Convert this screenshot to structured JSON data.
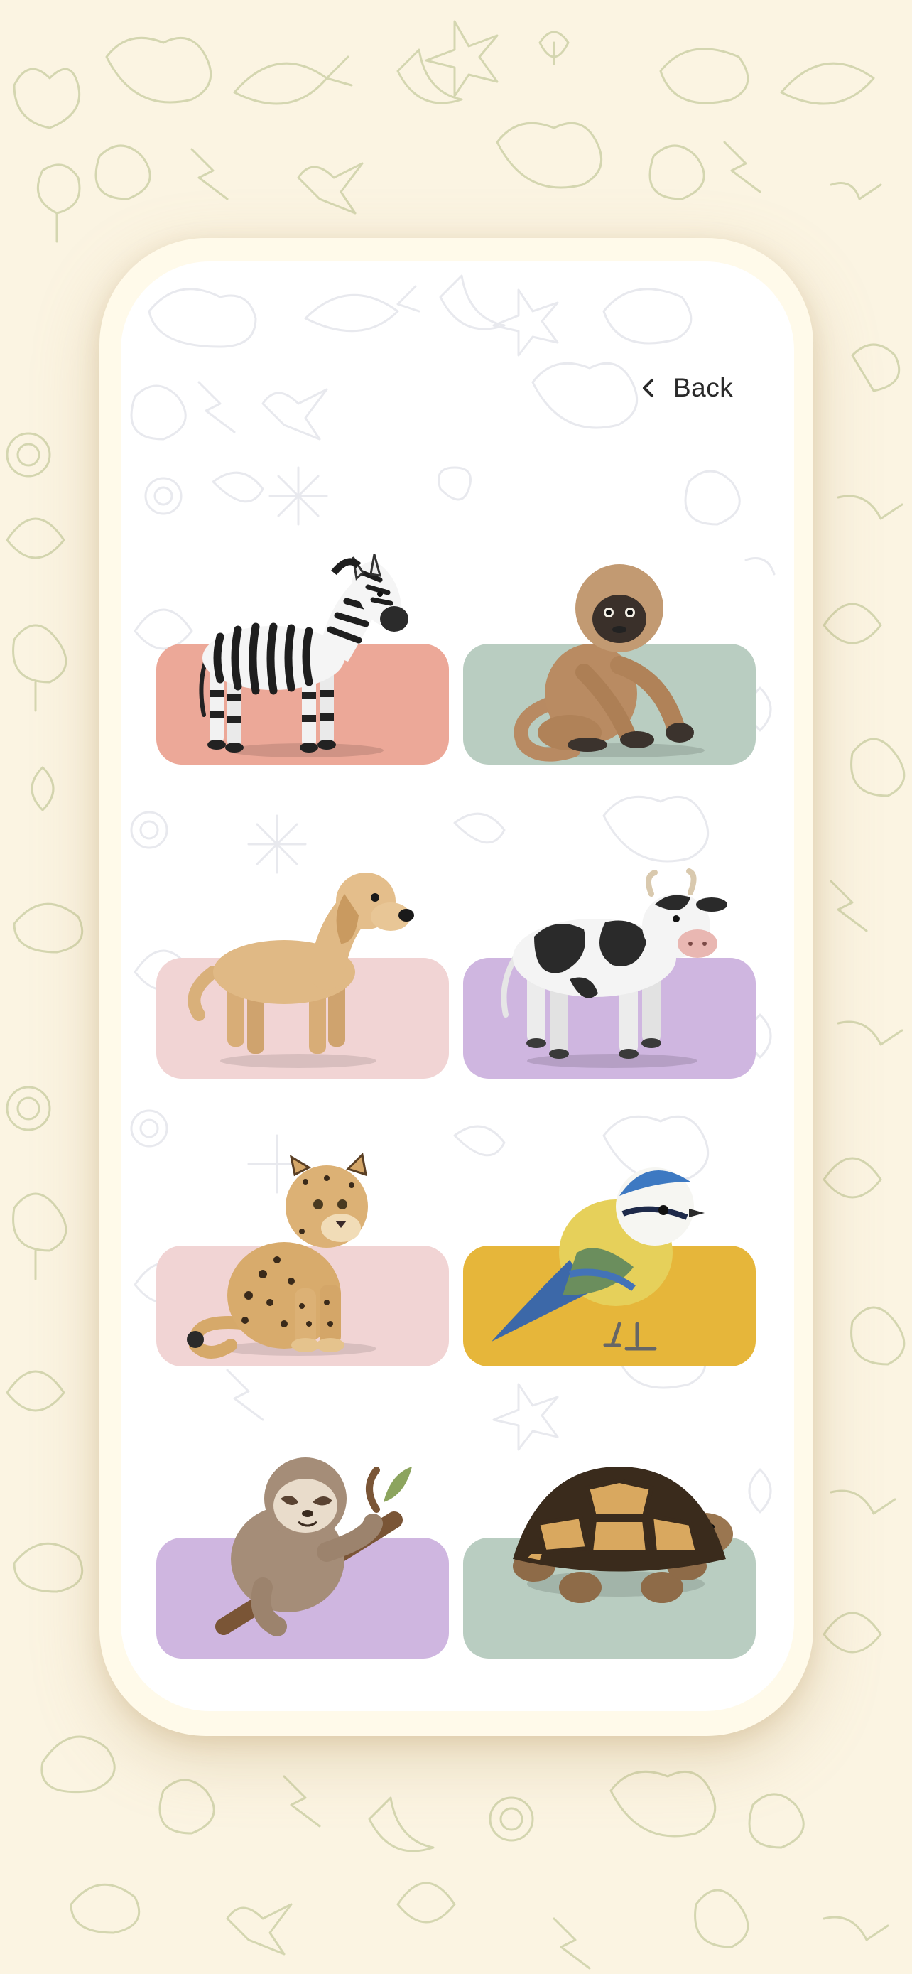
{
  "nav": {
    "back_label": "Back"
  },
  "colors": {
    "page_background": "#fbf4e2",
    "phone_frame": "#fffaea",
    "screen_background": "#ffffff"
  },
  "animals": [
    {
      "name": "zebra",
      "pad_color": "#eca898"
    },
    {
      "name": "gibbon",
      "pad_color": "#b9cdc1"
    },
    {
      "name": "golden-retriever",
      "pad_color": "#f1d4d4"
    },
    {
      "name": "cow",
      "pad_color": "#cfb6e0"
    },
    {
      "name": "leopard",
      "pad_color": "#f1d4d4"
    },
    {
      "name": "blue-tit",
      "pad_color": "#e6b63a"
    },
    {
      "name": "sloth",
      "pad_color": "#cfb6e0"
    },
    {
      "name": "tortoise",
      "pad_color": "#b9cdc1"
    }
  ]
}
